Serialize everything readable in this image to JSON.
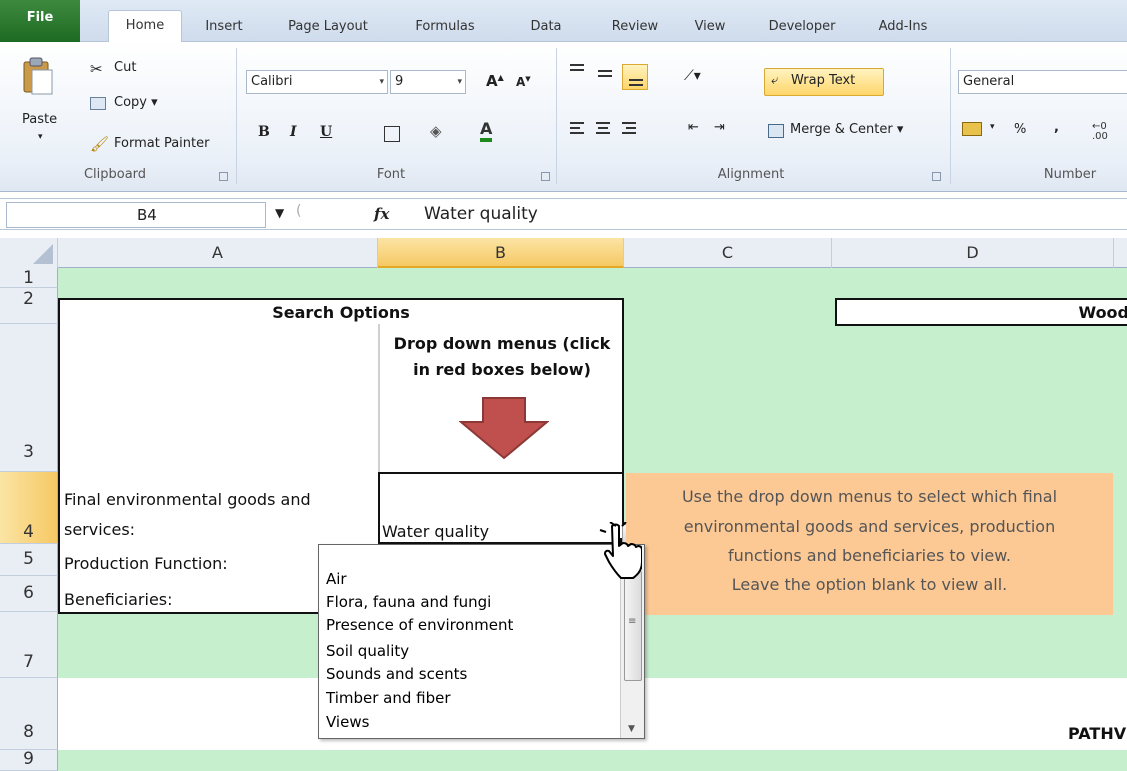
{
  "ribbon_tabs": [
    "File",
    "Home",
    "Insert",
    "Page Layout",
    "Formulas",
    "Data",
    "Review",
    "View",
    "Developer",
    "Add-Ins"
  ],
  "clipboard": {
    "paste": "Paste",
    "cut": "Cut",
    "copy": "Copy ▾",
    "format_painter": "Format Painter",
    "label": "Clipboard"
  },
  "font": {
    "name": "Calibri",
    "size": "9",
    "label": "Font",
    "bold": "B",
    "italic": "I",
    "underline": "U"
  },
  "alignment": {
    "wrap_text": "Wrap Text",
    "merge_center": "Merge & Center ▾",
    "label": "Alignment"
  },
  "number": {
    "format": "General",
    "percent": "%",
    "comma": ",",
    "label": "Number"
  },
  "formula_bar": {
    "name_box": "B4",
    "fx": "fx",
    "formula": "Water quality"
  },
  "columns": [
    "A",
    "B",
    "C",
    "D"
  ],
  "rows": [
    "1",
    "2",
    "3",
    "4",
    "5",
    "6",
    "7",
    "8",
    "9"
  ],
  "sheet": {
    "search_options": "Search Options",
    "wood_header": "Wood",
    "dropdown_hint_line1": "Drop down menus (click",
    "dropdown_hint_line2": "in red boxes below)",
    "final_goods_line1": "Final environmental goods and",
    "final_goods_line2": "services:",
    "production_function": "Production Function:",
    "beneficiaries": "Beneficiaries:",
    "b4_value": "Water quality",
    "pathw": "PATHV"
  },
  "info_box": {
    "line1": "Use the drop down menus to select which final",
    "line2": "environmental goods and services, production",
    "line3": "functions and beneficiaries to view.",
    "line4": "Leave the option blank to view all."
  },
  "dropdown_options": [
    "Air",
    "Flora, fauna and fungi",
    "Presence of environment",
    "Soil quality",
    "Sounds and scents",
    "Timber and fiber",
    "Views"
  ],
  "colors": {
    "sheet_green": "#c6efce",
    "info_orange": "#fcc995",
    "arrow_red": "#c0504d",
    "file_tab_green": "#2e7d32"
  }
}
